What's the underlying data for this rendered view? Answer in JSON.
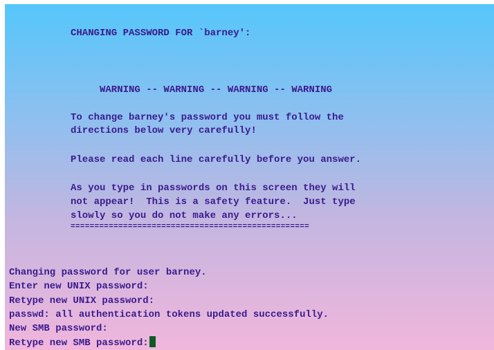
{
  "banner": {
    "title": "CHANGING PASSWORD FOR `barney':",
    "warning": "WARNING -- WARNING -- WARNING -- WARNING",
    "instructions_1": "To change barney's password you must follow the",
    "instructions_2": "directions below very carefully!",
    "read_note": "Please read each line carefully before you answer.",
    "safety_1": "As you type in passwords on this screen they will",
    "safety_2": "not appear!  This is a safety feature.  Just type",
    "safety_3": "slowly so you do not make any errors...",
    "separator": "=================================================="
  },
  "output": {
    "line_1": "Changing password for user barney.",
    "line_2": "Enter new UNIX password:",
    "line_3": "Retype new UNIX password:",
    "line_4": "passwd: all authentication tokens updated successfully.",
    "line_5": "New SMB password:",
    "line_6": "Retype new SMB password:"
  },
  "colors": {
    "text": "#3a1a8c",
    "cursor": "#0f5a22",
    "background_top": "#55c6fb",
    "background_bottom": "#f1b6dc"
  }
}
